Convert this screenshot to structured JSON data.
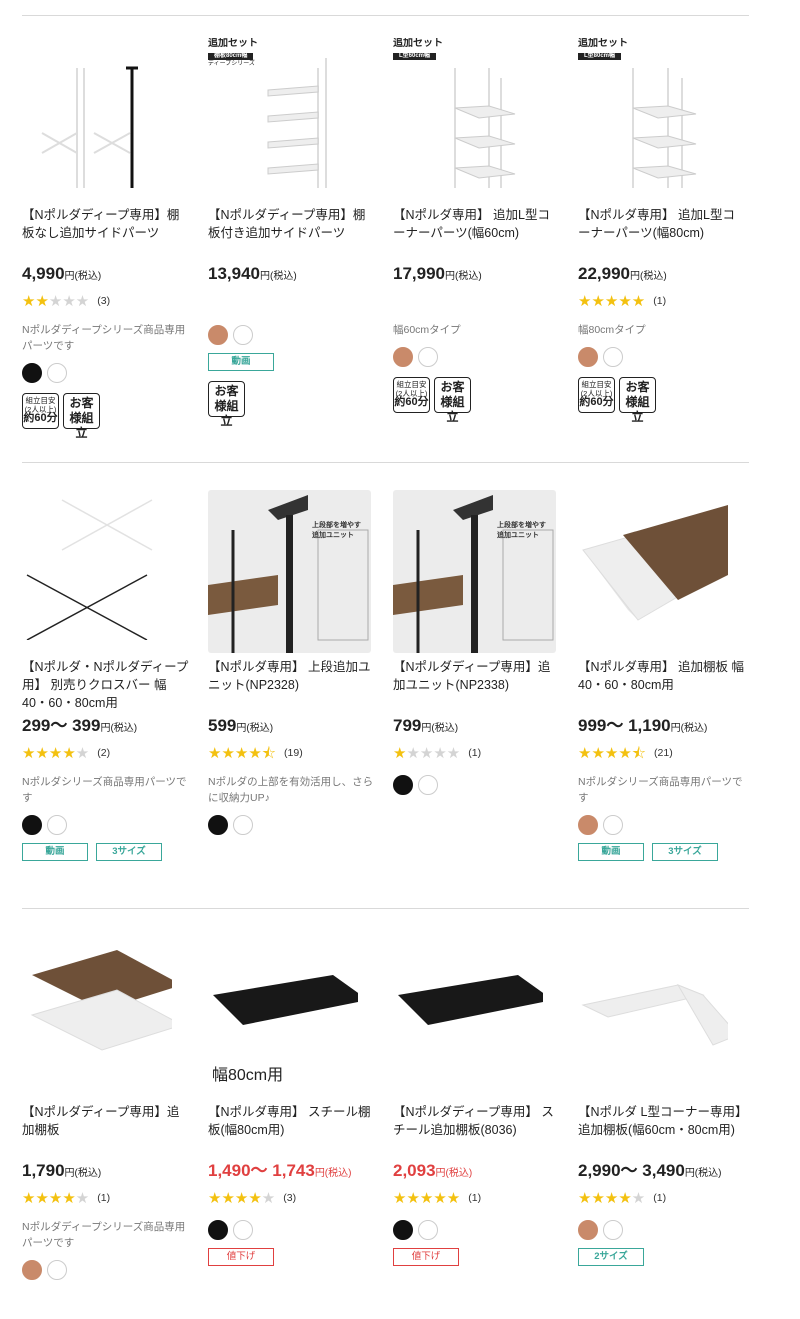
{
  "products": [
    {
      "title": "【Nポルダディープ専用】棚板なし追加サイドパーツ",
      "price": "4,990",
      "tax": "円(税込)",
      "rating": 1.5,
      "review_count": "(3)",
      "description": "Nポルダディープシリーズ商品専用パーツです",
      "colors": [
        "#111111",
        "#ffffff"
      ],
      "assembly": {
        "time_line1": "組立目安",
        "time_line2": "(2人以上)",
        "time_line3": "約60分",
        "customer": "お客様組立"
      }
    },
    {
      "title": "【Nポルダディープ専用】棚板付き追加サイドパーツ",
      "price": "13,940",
      "tax": "円(税込)",
      "badge": {
        "title": "追加セット",
        "bar": "棚板80cm幅",
        "sub": "ディープシリーズ"
      },
      "colors": [
        "#c98a6a",
        "#ffffff"
      ],
      "tags": [
        "動画"
      ],
      "assembly": {
        "customer": "お客様組立"
      }
    },
    {
      "title": "【Nポルダ専用】 追加L型コーナーパーツ(幅60cm)",
      "price": "17,990",
      "tax": "円(税込)",
      "badge": {
        "title": "追加セット",
        "bar": "L型60cm幅"
      },
      "description": "幅60cmタイプ",
      "colors": [
        "#c98a6a",
        "#ffffff"
      ],
      "assembly": {
        "time_line1": "組立目安",
        "time_line2": "(2人以上)",
        "time_line3": "約60分",
        "customer": "お客様組立"
      }
    },
    {
      "title": "【Nポルダ専用】 追加L型コーナーパーツ(幅80cm)",
      "price": "22,990",
      "tax": "円(税込)",
      "badge": {
        "title": "追加セット",
        "bar": "L型80cm幅"
      },
      "rating": 5,
      "review_count": "(1)",
      "description": "幅80cmタイプ",
      "colors": [
        "#c98a6a",
        "#ffffff"
      ],
      "assembly": {
        "time_line1": "組立目安",
        "time_line2": "(2人以上)",
        "time_line3": "約60分",
        "customer": "お客様組立"
      }
    },
    {
      "title": "【Nポルダ・Nポルダディープ用】 別売りクロスバー 幅40・60・80cm用",
      "price": "299～ 399",
      "tax": "円(税込)",
      "rating": 4,
      "review_count": "(2)",
      "description": "Nポルダシリーズ商品専用パーツです",
      "colors": [
        "#111111",
        "#ffffff"
      ],
      "tags": [
        "動画",
        "3サイズ"
      ]
    },
    {
      "title": "【Nポルダ専用】 上段追加ユニット(NP2328)",
      "price": "599",
      "tax": "円(税込)",
      "image_caption": "上段部を増やす 追加ユニット",
      "rating": 4.5,
      "review_count": "(19)",
      "description": "Nポルダの上部を有効活用し、さらに収納力UP♪",
      "colors": [
        "#111111",
        "#ffffff"
      ]
    },
    {
      "title": "【Nポルダディープ専用】追加ユニット(NP2338)",
      "price": "799",
      "tax": "円(税込)",
      "image_caption": "上段部を増やす 追加ユニット",
      "rating": 1,
      "review_count": "(1)",
      "colors": [
        "#111111",
        "#ffffff"
      ]
    },
    {
      "title": "【Nポルダ専用】 追加棚板 幅40・60・80cm用",
      "price": "999～ 1,190",
      "tax": "円(税込)",
      "rating": 4.5,
      "review_count": "(21)",
      "description": "Nポルダシリーズ商品専用パーツです",
      "colors": [
        "#c98a6a",
        "#ffffff"
      ],
      "tags": [
        "動画",
        "3サイズ"
      ]
    },
    {
      "title": "【Nポルダディープ専用】追加棚板",
      "price": "1,790",
      "tax": "円(税込)",
      "rating": 4,
      "review_count": "(1)",
      "description": "Nポルダディープシリーズ商品専用パーツです",
      "colors": [
        "#c98a6a",
        "#ffffff"
      ]
    },
    {
      "title": "【Nポルダ専用】 スチール棚板(幅80cm用)",
      "price": "1,490～ 1,743",
      "tax": "円(税込)",
      "sale": true,
      "image_caption": "幅80cm用",
      "rating": 4,
      "review_count": "(3)",
      "colors": [
        "#111111",
        "#ffffff"
      ],
      "red_tags": [
        "値下げ"
      ]
    },
    {
      "title": "【Nポルダディープ専用】 スチール追加棚板(8036)",
      "price": "2,093",
      "tax": "円(税込)",
      "sale": true,
      "rating": 5,
      "review_count": "(1)",
      "colors": [
        "#111111",
        "#ffffff"
      ],
      "red_tags": [
        "値下げ"
      ]
    },
    {
      "title": "【Nポルダ L型コーナー専用】追加棚板(幅60cm・80cm用)",
      "price": "2,990～ 3,490",
      "tax": "円(税込)",
      "rating": 4,
      "review_count": "(1)",
      "colors": [
        "#c98a6a",
        "#ffffff"
      ],
      "tags": [
        "2サイズ"
      ]
    }
  ]
}
